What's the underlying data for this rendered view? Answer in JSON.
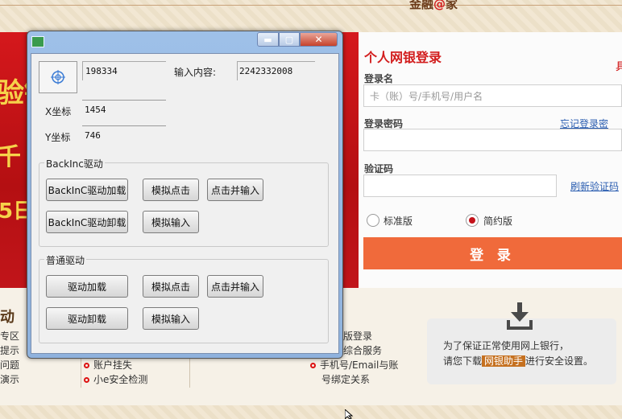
{
  "bank": {
    "brand_text": "金融",
    "brand_at": "@",
    "brand_suffix": "家",
    "banner_texts": [
      "验锄",
      "千",
      "5日"
    ],
    "login": {
      "title": "个人网银登录",
      "side_char": "具",
      "username_label": "登录名",
      "username_placeholder": "卡（账）号/手机号/用户名",
      "password_label": "登录密码",
      "forgot_link": "忘记登录密码？",
      "captcha_label": "验证码",
      "refresh_captcha_link": "刷新验证码",
      "edition_standard": "标准版",
      "edition_simple": "简约版",
      "selected_edition": "简约版",
      "login_button": "登 录"
    },
    "bottom_left": {
      "heading": "动",
      "items": [
        "专区",
        "提示",
        "问题",
        "演示"
      ]
    },
    "bottom_mid": [
      "账户挂失",
      "小e安全检测"
    ],
    "bottom_right": [
      "版登录",
      "综合服务",
      "手机号/Email与账",
      "号绑定关系"
    ],
    "download": {
      "line1": "为了保证正常使用网上银行，",
      "line2_prefix": "请您下载",
      "line2_badge": "网银助手",
      "line2_suffix": "进行安全设置。"
    }
  },
  "tool_window": {
    "handle_value": "198334",
    "input_label": "输入内容:",
    "input_value": "2242332008",
    "x_label": "X坐标",
    "x_value": "1454",
    "y_label": "Y坐标",
    "y_value": "746",
    "group1": {
      "title": "BackInc驱动",
      "load_button": "BackInC驱动加载",
      "unload_button": "BackInC驱动卸载",
      "click_button": "模拟点击",
      "click_input_button": "点击并输入",
      "input_button": "模拟输入"
    },
    "group2": {
      "title": "普通驱动",
      "load_button": "驱动加载",
      "unload_button": "驱动卸载",
      "click_button": "模拟点击",
      "click_input_button": "点击并输入",
      "input_button": "模拟输入"
    }
  },
  "colors": {
    "banner_red": "#c1151a",
    "accent_red": "#d21d1d",
    "login_orange": "#f06a3b",
    "link_blue": "#2a5db0",
    "window_frame": "#9ec0e8"
  }
}
